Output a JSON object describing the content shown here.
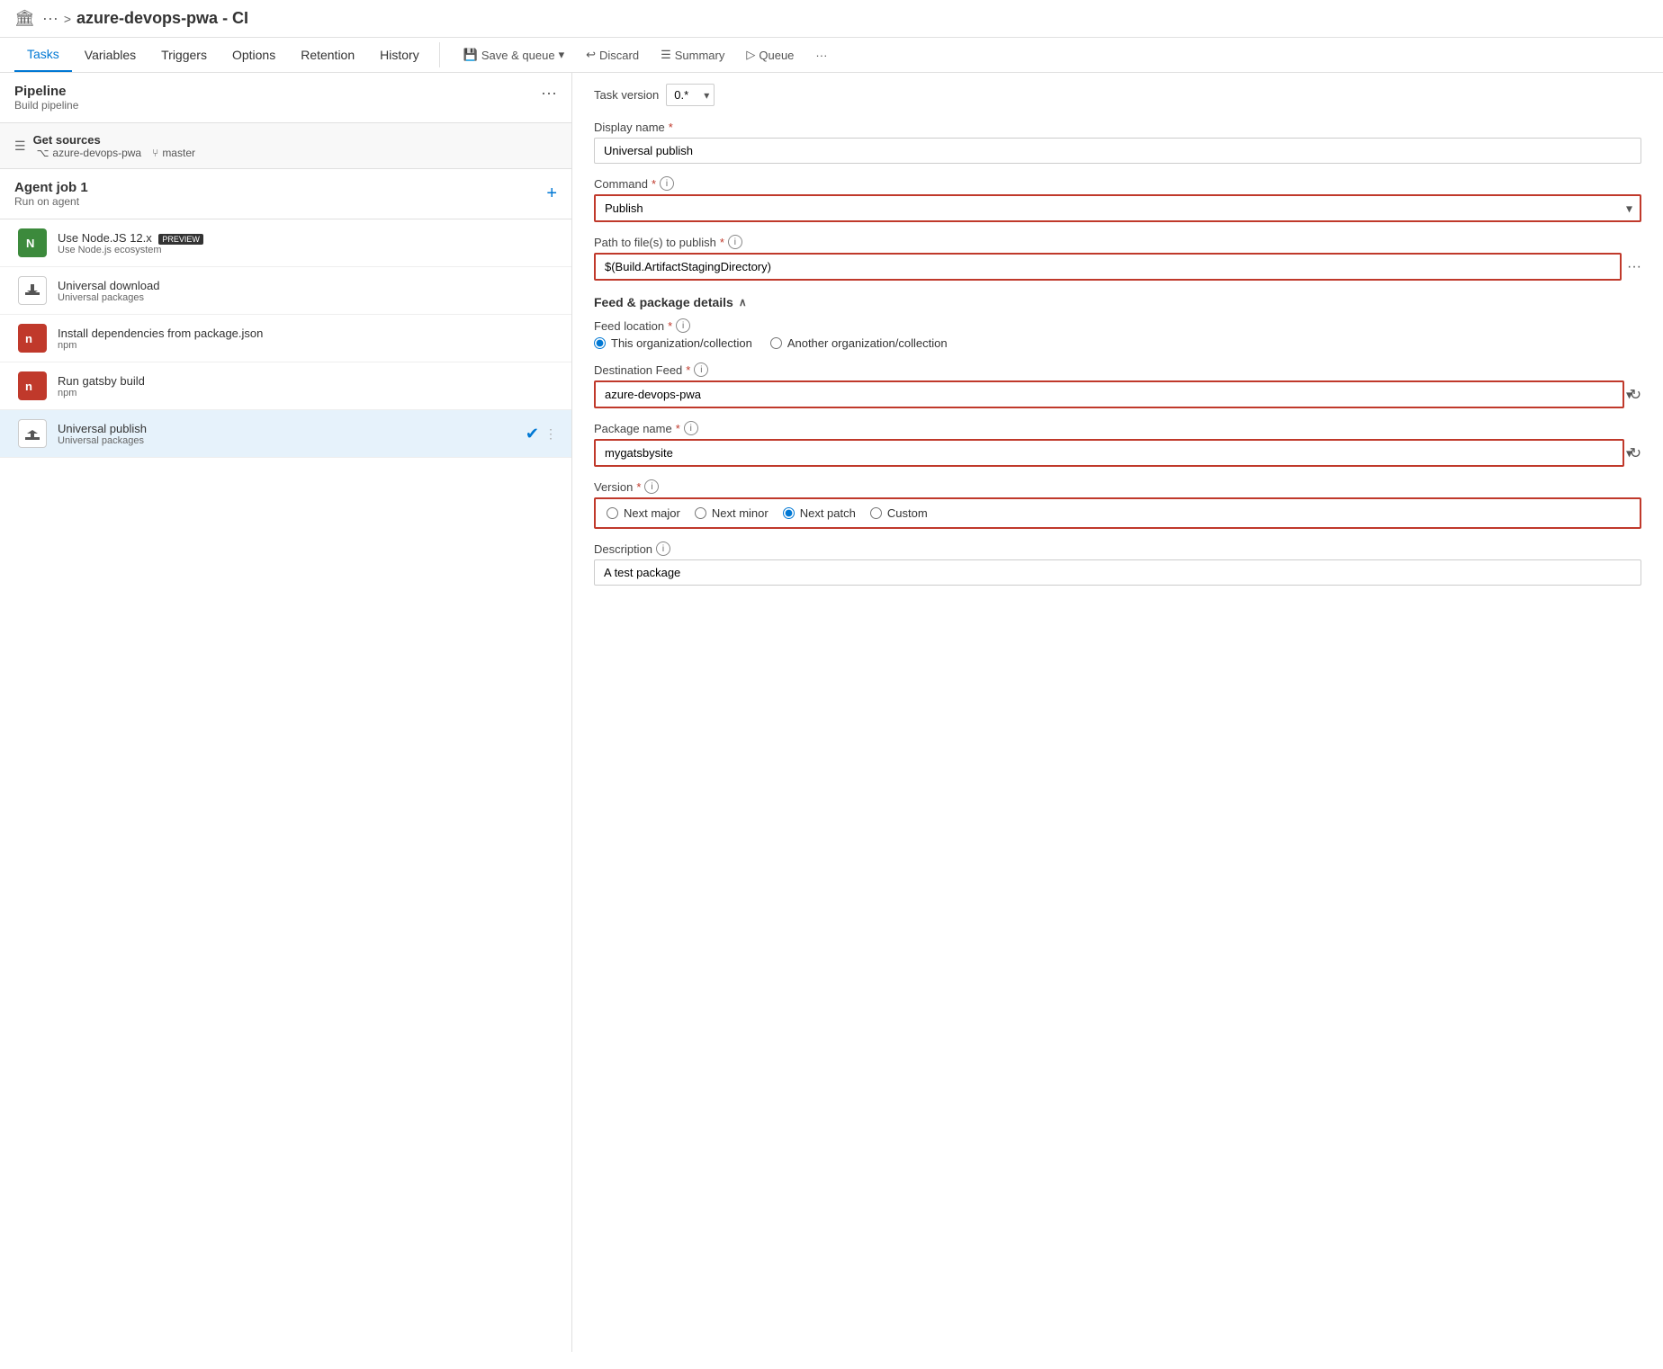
{
  "header": {
    "icon": "🏛",
    "dots": "···",
    "arrow": ">",
    "title": "azure-devops-pwa - CI"
  },
  "nav": {
    "tabs": [
      {
        "label": "Tasks",
        "active": true
      },
      {
        "label": "Variables",
        "active": false
      },
      {
        "label": "Triggers",
        "active": false
      },
      {
        "label": "Options",
        "active": false
      },
      {
        "label": "Retention",
        "active": false
      },
      {
        "label": "History",
        "active": false
      }
    ],
    "actions": [
      {
        "label": "Save & queue",
        "icon": "💾",
        "disabled": false,
        "has_dropdown": true
      },
      {
        "label": "Discard",
        "icon": "↩",
        "disabled": false
      },
      {
        "label": "Summary",
        "icon": "☰",
        "disabled": false
      },
      {
        "label": "Queue",
        "icon": "▷",
        "disabled": false
      },
      {
        "label": "···",
        "icon": "",
        "disabled": false
      }
    ]
  },
  "left_panel": {
    "pipeline": {
      "title": "Pipeline",
      "subtitle": "Build pipeline",
      "dots": "···"
    },
    "get_sources": {
      "title": "Get sources",
      "repo": "azure-devops-pwa",
      "branch": "master"
    },
    "agent_job": {
      "title": "Agent job 1",
      "subtitle": "Run on agent"
    },
    "tasks": [
      {
        "id": "node",
        "name": "Use Node.JS 12.x",
        "badge": "PREVIEW",
        "subtitle": "Use Node.js ecosystem",
        "icon_color": "green",
        "icon_char": "N",
        "selected": false
      },
      {
        "id": "universal-download",
        "name": "Universal download",
        "subtitle": "Universal packages",
        "icon_color": "white-border",
        "icon_char": "⬇",
        "selected": false
      },
      {
        "id": "install-deps",
        "name": "Install dependencies from package.json",
        "subtitle": "npm",
        "icon_color": "red",
        "icon_char": "n",
        "selected": false
      },
      {
        "id": "gatsby-build",
        "name": "Run gatsby build",
        "subtitle": "npm",
        "icon_color": "red",
        "icon_char": "n",
        "selected": false
      },
      {
        "id": "universal-publish",
        "name": "Universal publish",
        "subtitle": "Universal packages",
        "icon_color": "white-border",
        "icon_char": "⬆",
        "selected": true
      }
    ]
  },
  "right_panel": {
    "task_version_label": "Task version",
    "task_version_value": "0.*",
    "display_name_label": "Display name",
    "display_name_required": "*",
    "display_name_value": "Universal publish",
    "command_label": "Command",
    "command_required": "*",
    "command_value": "Publish",
    "path_label": "Path to file(s) to publish",
    "path_required": "*",
    "path_value": "$(Build.ArtifactStagingDirectory)",
    "feed_section_title": "Feed & package details",
    "feed_location_label": "Feed location",
    "feed_location_required": "*",
    "feed_location_options": [
      {
        "label": "This organization/collection",
        "value": "this-org",
        "selected": true
      },
      {
        "label": "Another organization/collection",
        "value": "another-org",
        "selected": false
      }
    ],
    "destination_feed_label": "Destination Feed",
    "destination_feed_required": "*",
    "destination_feed_value": "azure-devops-pwa",
    "package_name_label": "Package name",
    "package_name_required": "*",
    "package_name_value": "mygatsbysite",
    "version_label": "Version",
    "version_required": "*",
    "version_options": [
      {
        "label": "Next major",
        "value": "next-major",
        "selected": false
      },
      {
        "label": "Next minor",
        "value": "next-minor",
        "selected": false
      },
      {
        "label": "Next patch",
        "value": "next-patch",
        "selected": true
      },
      {
        "label": "Custom",
        "value": "custom",
        "selected": false
      }
    ],
    "description_label": "Description",
    "description_value": "A test package"
  }
}
